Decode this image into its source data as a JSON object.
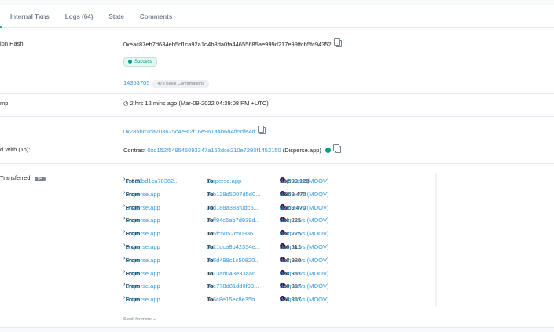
{
  "tabs": [
    "Internal Txns",
    "Logs (64)",
    "State",
    "Comments"
  ],
  "tx_hash": {
    "label": "ion Hash:",
    "value": "0xeac87eb7d634eb5d1ca92a1d4b8da0fa44655685ae999d217e99ffcb5fc94352"
  },
  "status": {
    "text": "Success"
  },
  "block": {
    "number": "14353705",
    "confirmations": "478 Block Confirmations"
  },
  "timestamp": {
    "label": "mp:",
    "value": "2 hrs 12 mins ago (Mar-09-2022 04:39:08 PM +UTC)"
  },
  "from": {
    "value": "0x285bd1ca703625c4e8f2f16e961a4b6b4d5dfe4d"
  },
  "interacted_with": {
    "label": "d With (To):",
    "prefix": "Contract",
    "address": "0xd152f549545093347a162dce210e7293f1452150",
    "name": "(Disperse.app)"
  },
  "tokens": {
    "label": "Transferred:",
    "count": "64",
    "scroll_more": "Scroll for more"
  },
  "transfers": [
    {
      "from": "0x285bd1ca70362...",
      "to": "Disperse.app",
      "amount": "75,600,128",
      "token": "dotmoovs (MOOV)"
    },
    {
      "from": "Disperse.app",
      "to": "0xb128d5007d5d0...",
      "amount": "1,069,470",
      "token": "dotmoovs (MOOV)"
    },
    {
      "from": "Disperse.app",
      "to": "0xd188a383f0dc5...",
      "amount": "1,069,470",
      "token": "dotmoovs (MOOV)"
    },
    {
      "from": "Disperse.app",
      "to": "0xff94c6ab7d939d...",
      "amount": "891,225",
      "token": "dotmoovs (MOOV)"
    },
    {
      "from": "Disperse.app",
      "to": "0x5fc5052c50936...",
      "amount": "891,225",
      "token": "dotmoovs (MOOV)"
    },
    {
      "from": "Disperse.app",
      "to": "0x21dca8b42354e...",
      "amount": "445,612",
      "token": "dotmoovs (MOOV)"
    },
    {
      "from": "Disperse.app",
      "to": "0x5d498c1c50820...",
      "amount": "712,980",
      "token": "dotmoovs (MOOV)"
    },
    {
      "from": "Disperse.app",
      "to": "0x13ad043e33aa6...",
      "amount": "623,857",
      "token": "dotmoovs (MOOV)"
    },
    {
      "from": "Disperse.app",
      "to": "0xe778d81dd0f93...",
      "amount": "623,857",
      "token": "dotmoovs (MOOV)"
    },
    {
      "from": "Disperse.app",
      "to": "0x6c8e15ec8e35b...",
      "amount": "623,857",
      "token": "dotmoovs (MOOV)"
    }
  ],
  "words": {
    "from": "From",
    "to": "To",
    "for": "For"
  }
}
